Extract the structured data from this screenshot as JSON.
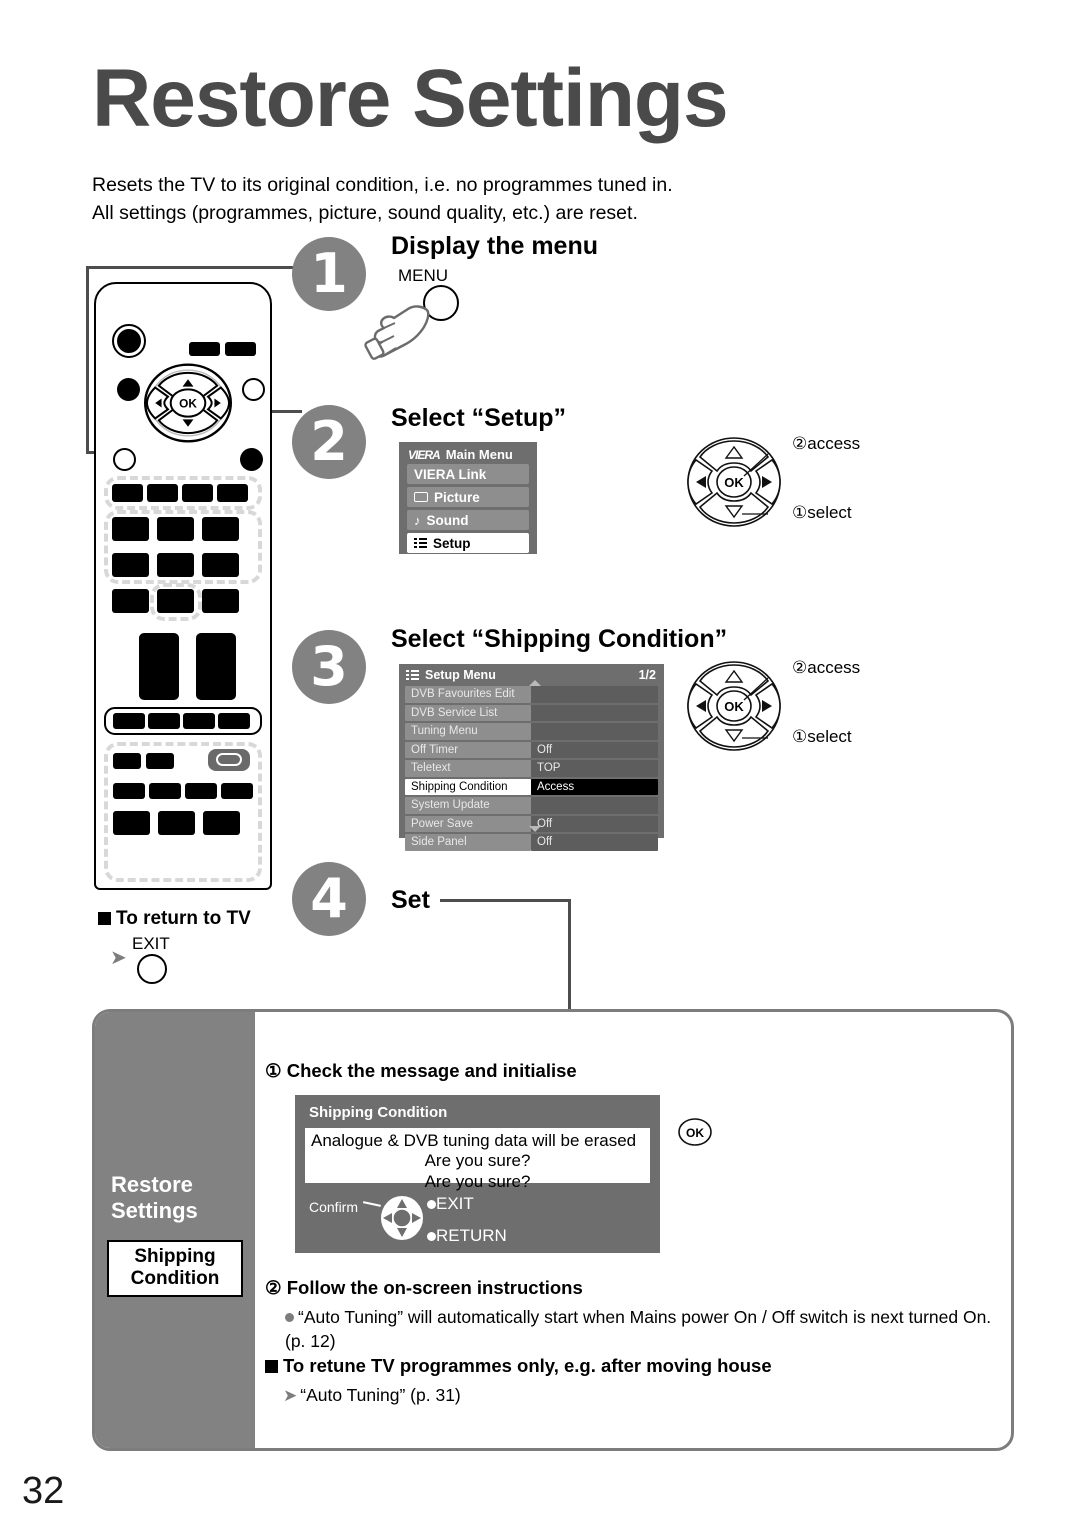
{
  "page": {
    "title": "Restore Settings",
    "number": "32",
    "intro_line1": "Resets the TV to its original condition, i.e. no programmes tuned in.",
    "intro_line2": "All settings (programmes, picture, sound quality, etc.) are reset."
  },
  "colors": {
    "step_circle": "#828282",
    "osd_bg": "#6e6e6e",
    "osd_row": "#8e8e8e",
    "selected_row": "#ffffff",
    "selected_value": "#000000",
    "panel_border": "#7d7d7d",
    "title_grey": "#4a4a4a"
  },
  "steps": [
    {
      "num": "1",
      "heading": "Display the menu"
    },
    {
      "num": "2",
      "heading": "Select “Setup”"
    },
    {
      "num": "3",
      "heading": "Select “Shipping Condition”"
    },
    {
      "num": "4",
      "heading": "Set"
    }
  ],
  "step1": {
    "button_label": "MENU"
  },
  "main_menu": {
    "brand": "VIERA",
    "title": "Main Menu",
    "items": [
      {
        "label": "VIERA Link",
        "icon": "none",
        "selected": false
      },
      {
        "label": "Picture",
        "icon": "picture-icon",
        "selected": false
      },
      {
        "label": "Sound",
        "icon": "note-icon",
        "selected": false
      },
      {
        "label": "Setup",
        "icon": "list-icon",
        "selected": true
      }
    ]
  },
  "setup_menu": {
    "title": "Setup Menu",
    "page_indicator": "1/2",
    "rows": [
      {
        "label": "DVB Favourites Edit",
        "value": "",
        "selected": false
      },
      {
        "label": "DVB Service List",
        "value": "",
        "selected": false
      },
      {
        "label": "Tuning Menu",
        "value": "",
        "selected": false
      },
      {
        "label": "Off Timer",
        "value": "Off",
        "selected": false
      },
      {
        "label": "Teletext",
        "value": "TOP",
        "selected": false
      },
      {
        "label": "Shipping Condition",
        "value": "Access",
        "selected": true
      },
      {
        "label": "System Update",
        "value": "",
        "selected": false
      },
      {
        "label": "Power Save",
        "value": "Off",
        "selected": false
      },
      {
        "label": "Side Panel",
        "value": "Off",
        "selected": false
      }
    ]
  },
  "navpad": {
    "ok_label": "OK",
    "access_label": "access",
    "select_label": "select",
    "access_num": "②",
    "select_num": "①"
  },
  "return_to_tv": {
    "heading": "To return to TV",
    "button_label": "EXIT"
  },
  "panel": {
    "side_title_line1": "Restore",
    "side_title_line2": "Settings",
    "chip_line1": "Shipping",
    "chip_line2": "Condition",
    "sub1_num": "①",
    "sub1": "Check the message and initialise",
    "sub2_num": "②",
    "sub2": "Follow the on-screen instructions",
    "sub2_bullet": "“Auto Tuning” will automatically start when Mains power On / Off switch is next turned On. (p. 12)",
    "sub3": "To retune TV programmes only, e.g. after moving house",
    "sub3_ref": "“Auto Tuning” (p. 31)"
  },
  "dialog": {
    "title": "Shipping Condition",
    "msg_line1": "Analogue & DVB tuning data will be erased",
    "msg_line2": "Are you sure?",
    "msg_line3": "Are you sure?",
    "confirm_label": "Confirm",
    "exit_label": "EXIT",
    "return_label": "RETURN",
    "ok_label": "OK"
  }
}
